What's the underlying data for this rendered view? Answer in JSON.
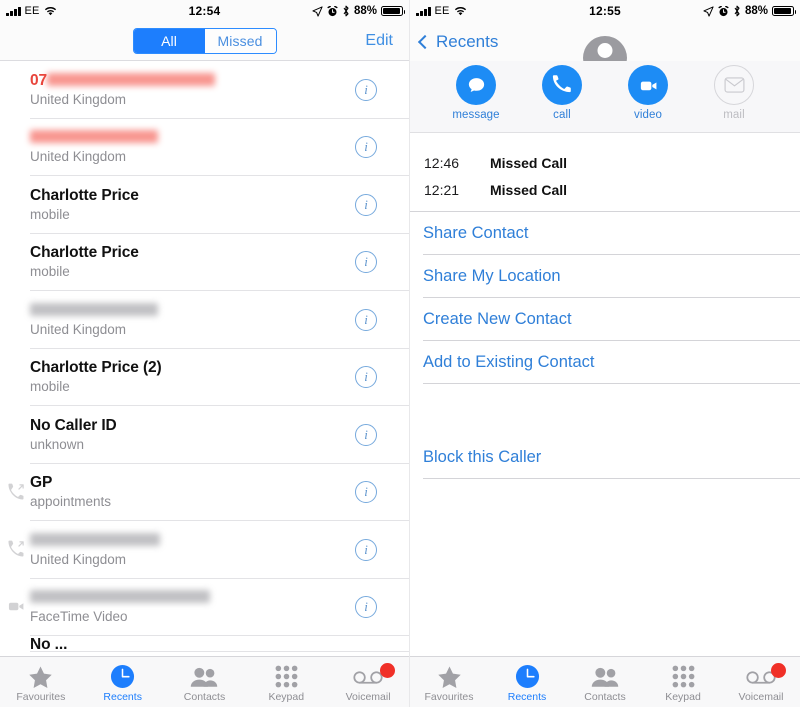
{
  "status_bar": {
    "carrier": "EE",
    "time_left": "12:54",
    "time_right": "12:55",
    "battery_pct": "88%",
    "icons": [
      "signal-bars-icon",
      "wifi-icon",
      "location-arrow-icon",
      "alarm-clock-icon",
      "bluetooth-icon",
      "battery-icon"
    ]
  },
  "left_panel": {
    "segmented": {
      "all": "All",
      "missed": "Missed",
      "selected": "All"
    },
    "edit": "Edit",
    "rows": [
      {
        "title": "07",
        "redacted": true,
        "redact_color": "red",
        "redact_width": 168,
        "subtitle": "United Kingdom",
        "missed": true,
        "call_type": ""
      },
      {
        "title": "",
        "redacted": true,
        "redact_color": "red",
        "redact_width": 128,
        "subtitle": "United Kingdom",
        "missed": true,
        "call_type": ""
      },
      {
        "title": "Charlotte Price",
        "redacted": false,
        "subtitle": "mobile",
        "missed": false,
        "call_type": ""
      },
      {
        "title": "Charlotte Price",
        "redacted": false,
        "subtitle": "mobile",
        "missed": false,
        "call_type": ""
      },
      {
        "title": "",
        "redacted": true,
        "redact_color": "gray",
        "redact_width": 128,
        "subtitle": "United Kingdom",
        "missed": false,
        "call_type": ""
      },
      {
        "title": "Charlotte Price (2)",
        "redacted": false,
        "subtitle": "mobile",
        "missed": false,
        "call_type": ""
      },
      {
        "title": "No Caller ID",
        "redacted": false,
        "subtitle": "unknown",
        "missed": false,
        "call_type": ""
      },
      {
        "title": "GP",
        "redacted": false,
        "subtitle": "appointments",
        "missed": false,
        "call_type": "outgoing-call-icon"
      },
      {
        "title": "",
        "redacted": true,
        "redact_color": "gray",
        "redact_width": 130,
        "subtitle": "United Kingdom",
        "missed": false,
        "call_type": "outgoing-call-icon"
      },
      {
        "title": "",
        "redacted": true,
        "redact_color": "gray",
        "redact_width": 180,
        "subtitle": "FaceTime Video",
        "missed": false,
        "call_type": "facetime-video-icon"
      }
    ],
    "partial_row_title": "No ...",
    "info_icon": "info-circle-icon"
  },
  "right_panel": {
    "back_label": "Recents",
    "back_icon": "chevron-left-icon",
    "avatar_icon": "person-placeholder-icon",
    "contact_name_redacted": true,
    "actions": [
      {
        "label": "message",
        "icon": "message-bubble-icon",
        "enabled": true
      },
      {
        "label": "call",
        "icon": "phone-handset-icon",
        "enabled": true
      },
      {
        "label": "video",
        "icon": "video-camera-icon",
        "enabled": true
      },
      {
        "label": "mail",
        "icon": "envelope-icon",
        "enabled": false
      }
    ],
    "call_history": [
      {
        "time": "12:46",
        "kind": "Missed Call"
      },
      {
        "time": "12:21",
        "kind": "Missed Call"
      }
    ],
    "links_group_1": [
      "Share Contact",
      "Share My Location"
    ],
    "links_group_2": [
      "Create New Contact",
      "Add to Existing Contact"
    ],
    "links_group_3": [
      "Block this Caller"
    ]
  },
  "tabbar": {
    "items": [
      {
        "label": "Favourites",
        "icon": "star-icon",
        "active": false,
        "badge": false
      },
      {
        "label": "Recents",
        "icon": "clock-icon",
        "active": true,
        "badge": false
      },
      {
        "label": "Contacts",
        "icon": "people-icon",
        "active": false,
        "badge": false
      },
      {
        "label": "Keypad",
        "icon": "keypad-dots-icon",
        "active": false,
        "badge": false
      },
      {
        "label": "Voicemail",
        "icon": "voicemail-icon",
        "active": false,
        "badge": true
      }
    ]
  },
  "colors": {
    "accent_blue": "#1d7efd",
    "link_blue": "#2f7fd8",
    "missed_red": "#e8453c",
    "badge_red": "#f03028",
    "gray_text": "#8e8e93"
  }
}
